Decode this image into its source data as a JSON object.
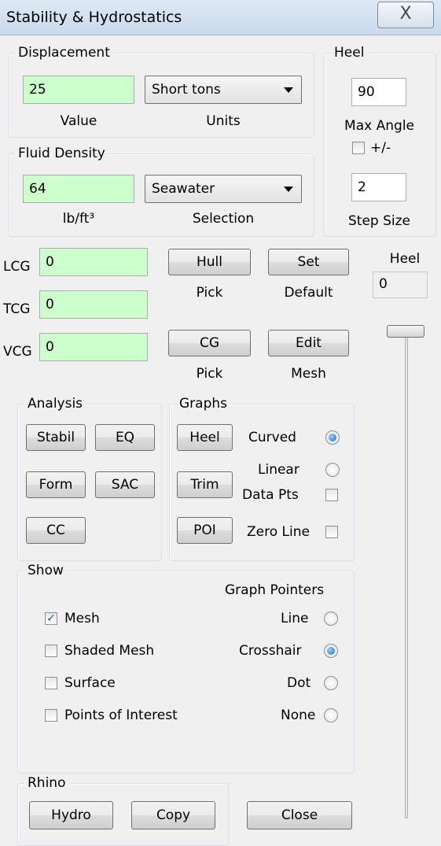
{
  "window": {
    "title": "Stability & Hydrostatics",
    "close_glyph": "X"
  },
  "displacement": {
    "legend": "Displacement",
    "value": "25",
    "value_label": "Value",
    "units_selected": "Short tons",
    "units_label": "Units"
  },
  "fluid_density": {
    "legend": "Fluid Density",
    "value": "64",
    "value_label": "lb/ft³",
    "selection_selected": "Seawater",
    "selection_label": "Selection"
  },
  "heel_group": {
    "legend": "Heel",
    "max_angle": "90",
    "max_angle_label": "Max Angle",
    "plus_minus_label": "+/-",
    "plus_minus_checked": false,
    "step_size": "2",
    "step_size_label": "Step Size"
  },
  "cg": {
    "lcg_label": "LCG",
    "lcg_value": "0",
    "tcg_label": "TCG",
    "tcg_value": "0",
    "vcg_label": "VCG",
    "vcg_value": "0"
  },
  "pick_buttons": {
    "hull": "Hull",
    "hull_caption": "Pick",
    "set": "Set",
    "set_caption": "Default",
    "cg": "CG",
    "cg_caption": "Pick",
    "edit": "Edit",
    "edit_caption": "Mesh"
  },
  "heel_readout": {
    "label": "Heel",
    "value": "0",
    "slider_level": 0
  },
  "analysis": {
    "legend": "Analysis",
    "stabil": "Stabil",
    "eq": "EQ",
    "form": "Form",
    "sac": "SAC",
    "cc": "CC"
  },
  "graphs": {
    "legend": "Graphs",
    "heel": "Heel",
    "trim": "Trim",
    "poi": "POI",
    "curved_label": "Curved",
    "curved_selected": true,
    "linear_label": "Linear",
    "linear_selected": false,
    "data_pts_label": "Data Pts",
    "data_pts_checked": false,
    "zero_line_label": "Zero Line",
    "zero_line_checked": false
  },
  "show": {
    "legend": "Show",
    "graph_pointers_label": "Graph Pointers",
    "mesh_label": "Mesh",
    "mesh_checked": true,
    "shaded_mesh_label": "Shaded Mesh",
    "shaded_mesh_checked": false,
    "surface_label": "Surface",
    "surface_checked": false,
    "poi_label": "Points of Interest",
    "poi_checked": false,
    "line_label": "Line",
    "line_selected": false,
    "crosshair_label": "Crosshair",
    "crosshair_selected": true,
    "dot_label": "Dot",
    "dot_selected": false,
    "none_label": "None",
    "none_selected": false
  },
  "rhino": {
    "legend": "Rhino",
    "hydro": "Hydro",
    "copy": "Copy"
  },
  "footer": {
    "close": "Close"
  },
  "colors": {
    "input_green": "#ccffcc",
    "radio_selected": "#1c6bc4"
  }
}
